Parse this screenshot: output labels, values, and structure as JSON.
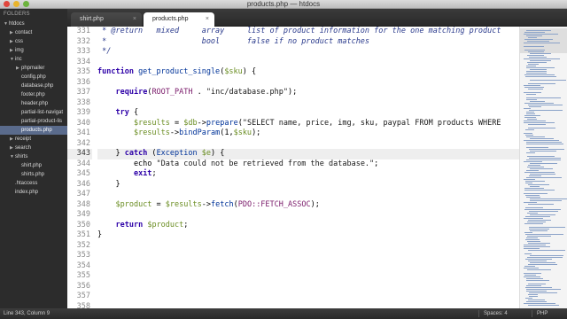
{
  "window": {
    "title": "products.php — htdocs"
  },
  "sidebar": {
    "header": "FOLDERS",
    "tree": [
      {
        "label": "htdocs",
        "depth": 0,
        "expanded": true
      },
      {
        "label": "contact",
        "depth": 1,
        "expanded": false
      },
      {
        "label": "css",
        "depth": 1,
        "expanded": false
      },
      {
        "label": "img",
        "depth": 1,
        "expanded": false
      },
      {
        "label": "inc",
        "depth": 1,
        "expanded": true
      },
      {
        "label": "phpmailer",
        "depth": 2,
        "expanded": false
      },
      {
        "label": "config.php",
        "depth": 2
      },
      {
        "label": "database.php",
        "depth": 2
      },
      {
        "label": "footer.php",
        "depth": 2
      },
      {
        "label": "header.php",
        "depth": 2
      },
      {
        "label": "partial-list-navigat",
        "depth": 2
      },
      {
        "label": "partial-product-lis",
        "depth": 2
      },
      {
        "label": "products.php",
        "depth": 2,
        "active": true
      },
      {
        "label": "receipt",
        "depth": 1,
        "expanded": false
      },
      {
        "label": "search",
        "depth": 1,
        "expanded": false
      },
      {
        "label": "shirts",
        "depth": 1,
        "expanded": true
      },
      {
        "label": "shirt.php",
        "depth": 2
      },
      {
        "label": "shirts.php",
        "depth": 2
      },
      {
        "label": ".htaccess",
        "depth": 1
      },
      {
        "label": "index.php",
        "depth": 1
      }
    ]
  },
  "tabs": [
    {
      "label": "shirt.php",
      "active": false,
      "close": "×"
    },
    {
      "label": "products.php",
      "active": true,
      "close": "×"
    }
  ],
  "editor": {
    "current_line": 343,
    "lines": [
      {
        "n": "331",
        "segs": [
          [
            "cmt",
            " * @return   mixed     array     list of product information for the one matching product"
          ]
        ]
      },
      {
        "n": "332",
        "segs": [
          [
            "cmt",
            " *                     bool      false if no product matches"
          ]
        ]
      },
      {
        "n": "333",
        "segs": [
          [
            "cmt",
            " */"
          ]
        ]
      },
      {
        "n": "334",
        "segs": []
      },
      {
        "n": "335",
        "segs": [
          [
            "kw",
            "function "
          ],
          [
            "fn",
            "get_product_single"
          ],
          [
            "plain",
            "("
          ],
          [
            "var",
            "$sku"
          ],
          [
            "plain",
            ") {"
          ]
        ]
      },
      {
        "n": "336",
        "segs": []
      },
      {
        "n": "337",
        "segs": [
          [
            "plain",
            "    "
          ],
          [
            "kw",
            "require"
          ],
          [
            "plain",
            "("
          ],
          [
            "cst",
            "ROOT_PATH"
          ],
          [
            "plain",
            " . "
          ],
          [
            "str",
            "\"inc/database.php\""
          ],
          [
            "plain",
            ");"
          ]
        ]
      },
      {
        "n": "338",
        "segs": []
      },
      {
        "n": "339",
        "segs": [
          [
            "plain",
            "    "
          ],
          [
            "kw",
            "try"
          ],
          [
            "plain",
            " {"
          ]
        ]
      },
      {
        "n": "340",
        "segs": [
          [
            "plain",
            "        "
          ],
          [
            "var",
            "$results"
          ],
          [
            "plain",
            " = "
          ],
          [
            "var",
            "$db"
          ],
          [
            "plain",
            "->"
          ],
          [
            "fn",
            "prepare"
          ],
          [
            "plain",
            "("
          ],
          [
            "str",
            "\"SELECT name, price, img, sku, paypal FROM products WHERE"
          ]
        ]
      },
      {
        "n": "341",
        "segs": [
          [
            "plain",
            "        "
          ],
          [
            "var",
            "$results"
          ],
          [
            "plain",
            "->"
          ],
          [
            "fn",
            "bindParam"
          ],
          [
            "plain",
            "(1,"
          ],
          [
            "var",
            "$sku"
          ],
          [
            "plain",
            ");"
          ]
        ]
      },
      {
        "n": "342",
        "segs": [
          [
            "plain",
            "        "
          ]
        ]
      },
      {
        "n": "343",
        "segs": [
          [
            "plain",
            "    } "
          ],
          [
            "kw",
            "catch"
          ],
          [
            "plain",
            " ("
          ],
          [
            "fn",
            "Exception"
          ],
          [
            "plain",
            " "
          ],
          [
            "var",
            "$e"
          ],
          [
            "plain",
            ") {"
          ]
        ]
      },
      {
        "n": "344",
        "segs": [
          [
            "plain",
            "        echo "
          ],
          [
            "str",
            "\"Data could not be retrieved from the database.\""
          ],
          [
            "plain",
            ";"
          ]
        ]
      },
      {
        "n": "345",
        "segs": [
          [
            "plain",
            "        "
          ],
          [
            "kw",
            "exit"
          ],
          [
            "plain",
            ";"
          ]
        ]
      },
      {
        "n": "346",
        "segs": [
          [
            "plain",
            "    }"
          ]
        ]
      },
      {
        "n": "347",
        "segs": []
      },
      {
        "n": "348",
        "segs": [
          [
            "plain",
            "    "
          ],
          [
            "var",
            "$product"
          ],
          [
            "plain",
            " = "
          ],
          [
            "var",
            "$results"
          ],
          [
            "plain",
            "->"
          ],
          [
            "fn",
            "fetch"
          ],
          [
            "plain",
            "("
          ],
          [
            "cst",
            "PDO::FETCH_ASSOC"
          ],
          [
            "plain",
            ");"
          ]
        ]
      },
      {
        "n": "349",
        "segs": []
      },
      {
        "n": "350",
        "segs": [
          [
            "plain",
            "    "
          ],
          [
            "kw",
            "return"
          ],
          [
            "plain",
            " "
          ],
          [
            "var",
            "$product"
          ],
          [
            "plain",
            ";"
          ]
        ]
      },
      {
        "n": "351",
        "segs": [
          [
            "plain",
            "}"
          ]
        ]
      },
      {
        "n": "352",
        "segs": []
      },
      {
        "n": "353",
        "segs": []
      },
      {
        "n": "354",
        "segs": []
      },
      {
        "n": "355",
        "segs": []
      },
      {
        "n": "356",
        "segs": []
      },
      {
        "n": "357",
        "segs": []
      },
      {
        "n": "358",
        "segs": []
      }
    ]
  },
  "statusbar": {
    "position": "Line 343, Column 9",
    "spaces": "Spaces: 4",
    "syntax": "PHP"
  },
  "colors": {
    "sidebar_bg": "#2c2c2c",
    "active_item": "#5a6b8c",
    "keyword": "#2d00a8",
    "variable": "#6b8e23"
  }
}
